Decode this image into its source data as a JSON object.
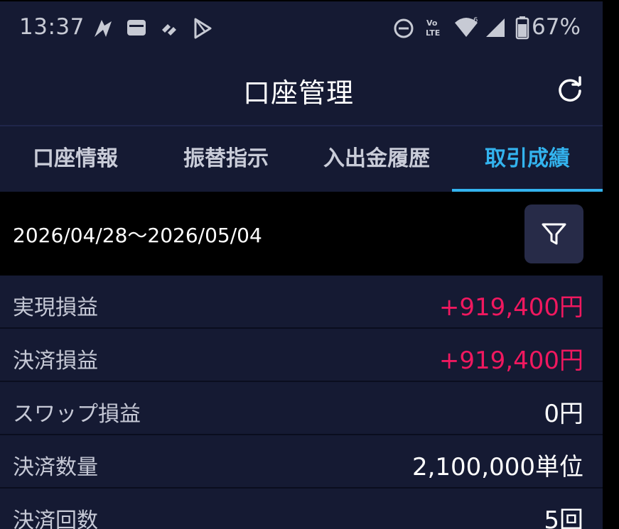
{
  "status_bar": {
    "time": "13:37",
    "battery_percent": "67%",
    "icons": [
      "tunnel-icon",
      "wallet-icon",
      "link-icon",
      "play-store-icon",
      "do-not-disturb-icon",
      "volte-icon",
      "wifi-icon",
      "signal-icon",
      "battery-icon"
    ]
  },
  "header": {
    "title": "口座管理",
    "refresh_icon": "refresh-icon"
  },
  "tabs": [
    {
      "label": "口座情報",
      "active": false
    },
    {
      "label": "振替指示",
      "active": false
    },
    {
      "label": "入出金履歴",
      "active": false
    },
    {
      "label": "取引成績",
      "active": true
    }
  ],
  "period": {
    "range": "2026/04/28～2026/05/04",
    "filter_icon": "filter-icon"
  },
  "stats": [
    {
      "label": "実現損益",
      "value": "+919,400円",
      "positive": true
    },
    {
      "label": "決済損益",
      "value": "+919,400円",
      "positive": true
    },
    {
      "label": "スワップ損益",
      "value": "0円",
      "positive": false
    },
    {
      "label": "決済数量",
      "value": "2,100,000単位",
      "positive": false
    },
    {
      "label": "決済回数",
      "value": "5回",
      "positive": false
    }
  ],
  "colors": {
    "background": "#151a33",
    "accent": "#33b3ee",
    "positive": "#f0185f"
  }
}
